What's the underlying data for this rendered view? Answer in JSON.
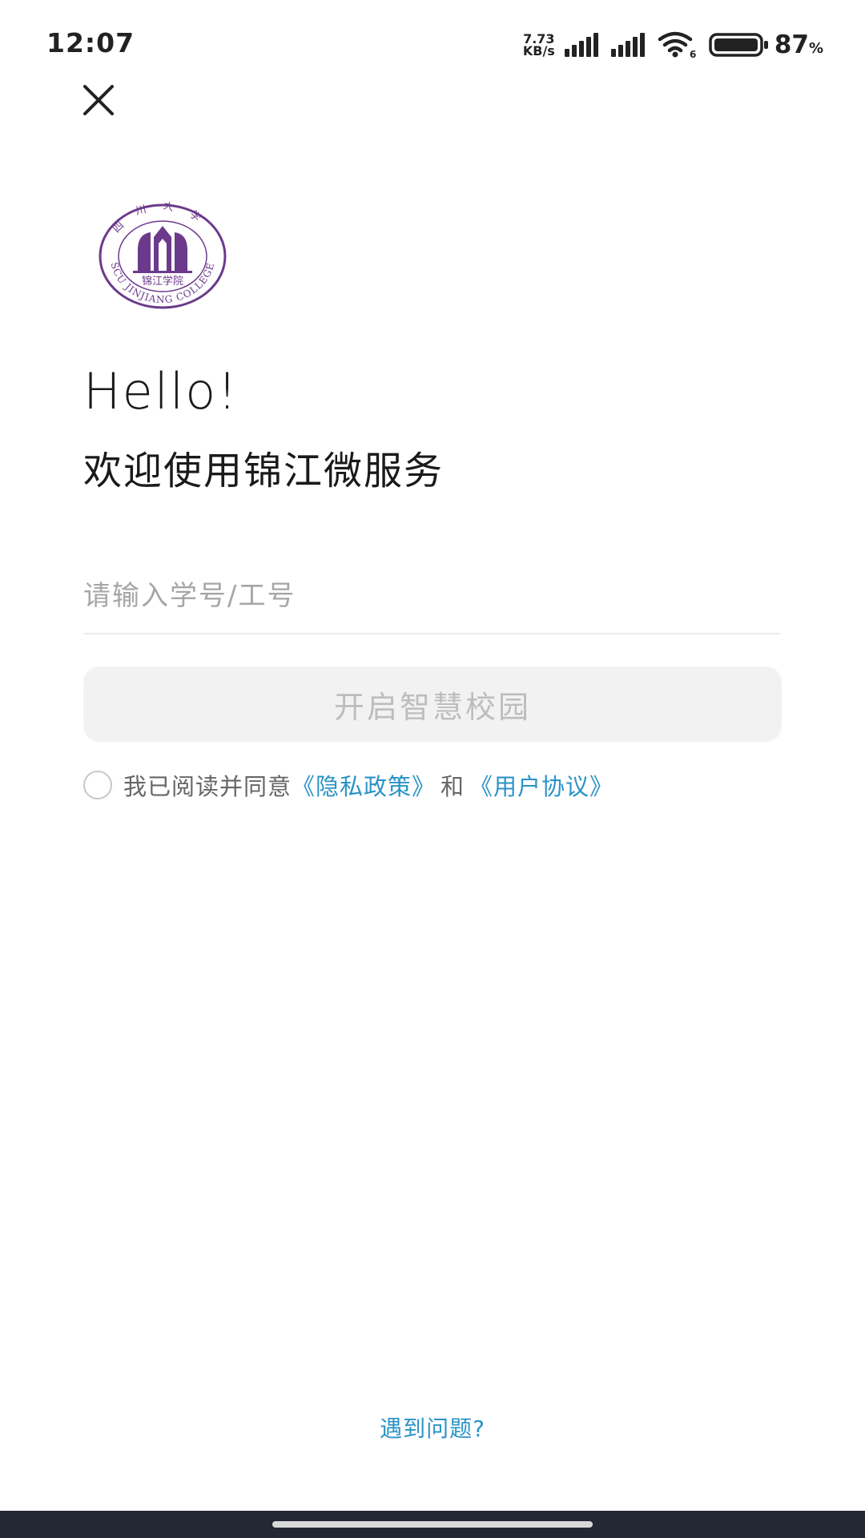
{
  "status_bar": {
    "time": "12:07",
    "net_speed_value": "7.73",
    "net_speed_unit": "KB/s",
    "wifi_badge": "6",
    "battery_value": "87",
    "battery_unit": "%"
  },
  "header": {
    "close_icon": "close-icon"
  },
  "logo": {
    "icon": "school-emblem",
    "inner_text": "锦江学院",
    "ring_text": "SCU JINJIANG COLLEGE",
    "top_text": "四川大学",
    "brand_color": "#6b3a8c"
  },
  "greeting": {
    "hello": "Hello!",
    "welcome": "欢迎使用锦江微服务"
  },
  "login": {
    "id_placeholder": "请输入学号/工号",
    "id_value": "",
    "submit_label": "开启智慧校园"
  },
  "agreement": {
    "checked": false,
    "prefix": "我已阅读并同意",
    "privacy_label": "《隐私政策》",
    "and": "和",
    "terms_label": "《用户协议》",
    "link_color": "#2a93c6"
  },
  "footer": {
    "help_label": "遇到问题?"
  }
}
